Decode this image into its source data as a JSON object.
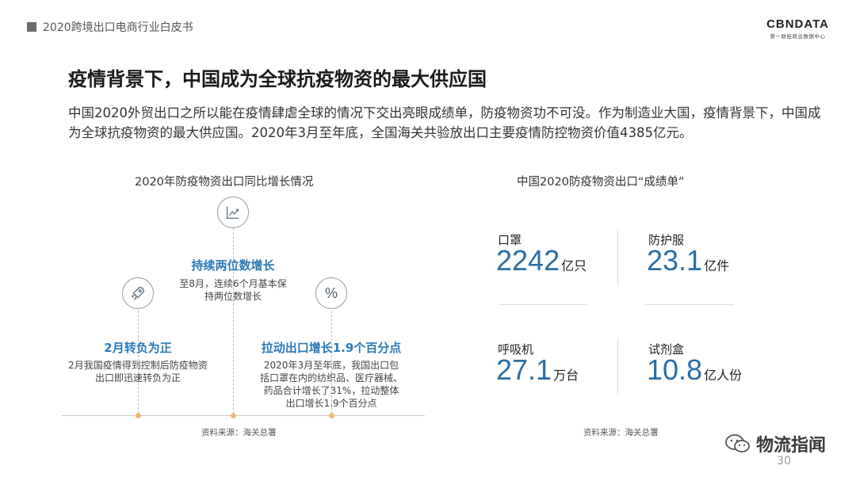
{
  "header": {
    "section_title": "2020跨境出口电商行业白皮书",
    "logo_main": "CBNDATA",
    "logo_sub": "第一财经商业数据中心"
  },
  "slide": {
    "title": "疫情背景下，中国成为全球抗疫物资的最大供应国",
    "intro": "中国2020外贸出口之所以能在疫情肆虐全球的情况下交出亮眼成绩单，防疫物资功不可没。作为制造业大国，疫情背景下，中国成为全球抗疫物资的最大供应国。2020年3月至年底，全国海关共验放出口主要疫情防控物资价值4385亿元。"
  },
  "left_panel": {
    "title": "2020年防疫物资出口同比增长情况",
    "points": [
      {
        "icon": "rocket-icon",
        "title": "2月转负为正",
        "desc": "2月我国疫情得到控制后防疫物资出口即迅速转负为正"
      },
      {
        "icon": "trend-chart-icon",
        "title": "持续两位数增长",
        "desc": "至8月，连续6个月基本保持两位数增长"
      },
      {
        "icon": "percent-icon",
        "icon_text": "%",
        "title": "拉动出口增长1.9个百分点",
        "desc": "2020年3月至年底，我国出口包括口罩在内的纺织品、医疗器械、药品合计增长了31%，拉动整体出口增长1.9个百分点"
      }
    ],
    "source": "资料来源：海关总署"
  },
  "right_panel": {
    "title": "中国2020防疫物资出口“成绩单”",
    "stats": [
      {
        "label": "口罩",
        "value": "2242",
        "unit": "亿只"
      },
      {
        "label": "防护服",
        "value": "23.1",
        "unit": "亿件"
      },
      {
        "label": "呼吸机",
        "value": "27.1",
        "unit": "万台"
      },
      {
        "label": "试剂盒",
        "value": "10.8",
        "unit": "亿人份"
      }
    ],
    "source": "资料来源：海关总署"
  },
  "footer": {
    "brand": "物流指闻",
    "page_number": "30"
  },
  "colors": {
    "accent_blue": "#2a7ab8",
    "timeline_dot": "#f0b86e"
  }
}
